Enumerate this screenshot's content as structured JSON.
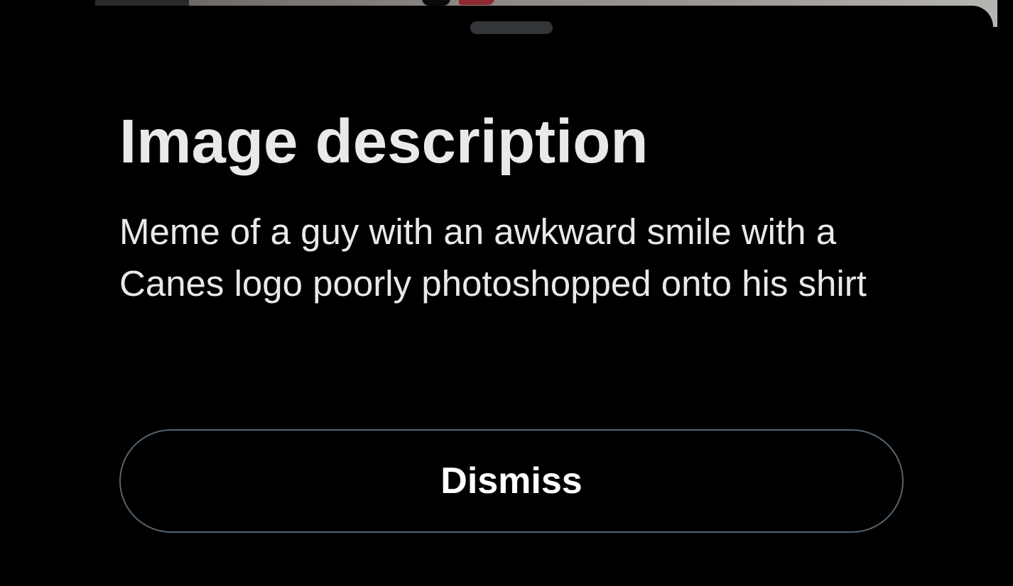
{
  "sheet": {
    "title": "Image description",
    "description": "Meme of a guy with an awkward smile with a Canes logo poorly photoshopped onto his shirt",
    "dismiss_label": "Dismiss"
  },
  "colors": {
    "background": "#000000",
    "text_primary": "#e7e9ea",
    "button_text": "#ffffff",
    "button_border": "#536471",
    "grabber": "#333639"
  }
}
